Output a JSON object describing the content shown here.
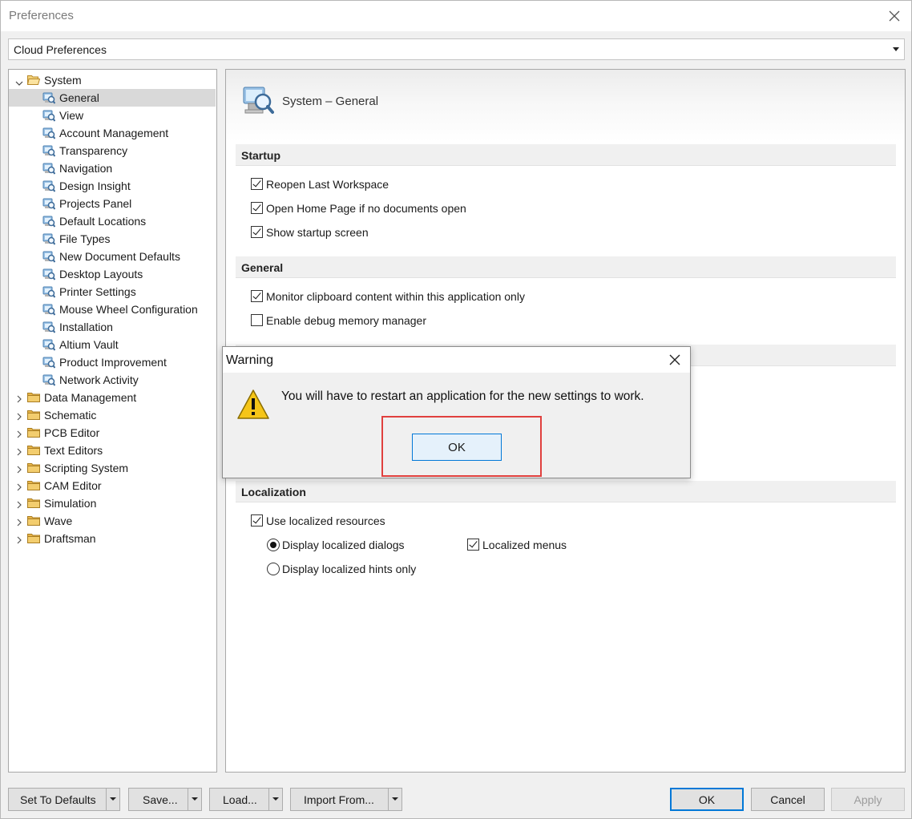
{
  "window": {
    "title": "Preferences"
  },
  "cloud_select": {
    "value": "Cloud Preferences"
  },
  "tree": {
    "system": "System",
    "system_children": [
      "General",
      "View",
      "Account Management",
      "Transparency",
      "Navigation",
      "Design Insight",
      "Projects Panel",
      "Default Locations",
      "File Types",
      "New Document Defaults",
      "Desktop Layouts",
      "Printer Settings",
      "Mouse Wheel Configuration",
      "Installation",
      "Altium Vault",
      "Product Improvement",
      "Network Activity"
    ],
    "selected": "General",
    "top_folders": [
      "Data Management",
      "Schematic",
      "PCB Editor",
      "Text Editors",
      "Scripting System",
      "CAM Editor",
      "Simulation",
      "Wave",
      "Draftsman"
    ]
  },
  "content": {
    "title": "System – General",
    "sections": {
      "startup": "Startup",
      "general": "General",
      "localization": "Localization"
    },
    "options": {
      "reopen_workspace": {
        "label": "Reopen Last Workspace",
        "checked": true
      },
      "open_home_page": {
        "label": "Open Home Page if no documents open",
        "checked": true
      },
      "show_startup_screen": {
        "label": "Show startup screen",
        "checked": true
      },
      "monitor_clipboard": {
        "label": "Monitor clipboard content within this application only",
        "checked": true
      },
      "debug_memory": {
        "label": "Enable debug memory manager",
        "checked": false
      },
      "use_localized": {
        "label": "Use localized resources",
        "checked": true
      },
      "display_dialogs": {
        "label": "Display localized dialogs",
        "selected": true
      },
      "display_hints": {
        "label": "Display localized hints only",
        "selected": false
      },
      "localized_menus": {
        "label": "Localized menus",
        "checked": true
      }
    }
  },
  "footer": {
    "set_defaults": "Set To Defaults",
    "save": "Save...",
    "load": "Load...",
    "import_from": "Import From...",
    "ok": "OK",
    "cancel": "Cancel",
    "apply": "Apply"
  },
  "warning": {
    "title": "Warning",
    "message": "You will have to restart an application for the new settings to work.",
    "ok": "OK"
  },
  "colors": {
    "highlight_border": "#e0403e",
    "ok_focus": "#0078d7",
    "folder": "#e8b54a"
  }
}
